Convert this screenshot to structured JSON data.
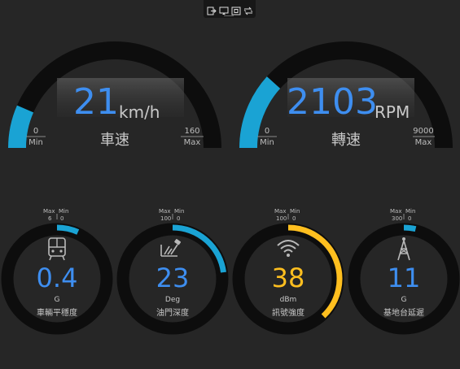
{
  "toolbar": {
    "icons": [
      "export-icon",
      "cast-icon",
      "fullscreen-icon",
      "flip-icon"
    ]
  },
  "colors": {
    "background": "#262626",
    "track": "#0d0d0d",
    "blue": "#3e8ef0",
    "cyan_fill": "#1aa3d4",
    "amber": "#ffbf1f",
    "label": "#c9c9c9"
  },
  "gauges": {
    "speed": {
      "value": "21",
      "unit": "km/h",
      "label": "車速",
      "min_value": "0",
      "min_label": "Min",
      "max_value": "160",
      "max_label": "Max",
      "fraction": 0.131
    },
    "rpm": {
      "value": "2103",
      "unit": "RPM",
      "label": "轉速",
      "min_value": "0",
      "min_label": "Min",
      "max_value": "9000",
      "max_label": "Max",
      "fraction": 0.234
    }
  },
  "small_gauges": [
    {
      "name": "g-force",
      "icon": "bus-icon",
      "value": "0.4",
      "unit": "G",
      "label": "車輛平穩度",
      "max_label": "Max",
      "min_label": "Min",
      "max_value": "6",
      "min_value": "0",
      "fraction": 0.067,
      "color": "blue"
    },
    {
      "name": "throttle",
      "icon": "throttle-icon",
      "value": "23",
      "unit": "Deg",
      "label": "油門深度",
      "max_label": "Max",
      "min_label": "Min",
      "max_value": "100",
      "min_value": "0",
      "fraction": 0.23,
      "color": "blue"
    },
    {
      "name": "signal",
      "icon": "wifi-icon",
      "value": "38",
      "unit": "dBm",
      "label": "訊號強度",
      "max_label": "Max",
      "min_label": "Min",
      "max_value": "100",
      "min_value": "0",
      "fraction": 0.38,
      "color": "amber"
    },
    {
      "name": "latency",
      "icon": "tower-icon",
      "value": "11",
      "unit": "G",
      "label": "基地台延遲",
      "max_label": "Max",
      "min_label": "Min",
      "max_value": "300",
      "min_value": "0",
      "fraction": 0.037,
      "color": "blue"
    }
  ]
}
